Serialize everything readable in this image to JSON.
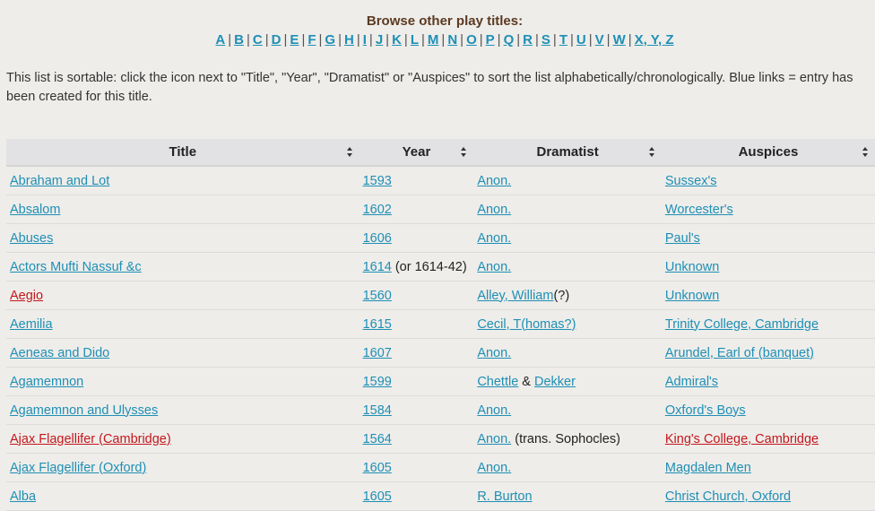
{
  "browse": {
    "heading": "Browse other play titles:",
    "letters": [
      "A",
      "B",
      "C",
      "D",
      "E",
      "F",
      "G",
      "H",
      "I",
      "J",
      "K",
      "L",
      "M",
      "N",
      "O",
      "P",
      "Q",
      "R",
      "S",
      "T",
      "U",
      "V",
      "W",
      "X, Y, Z"
    ],
    "separator": "|"
  },
  "intro_text": "This list is sortable: click the icon next to \"Title\", \"Year\", \"Dramatist\" or \"Auspices\" to sort the list alphabetically/chronologically. Blue links = entry has been created for this title.",
  "table": {
    "headers": [
      "Title",
      "Year",
      "Dramatist",
      "Auspices"
    ],
    "rows": [
      {
        "title": "Abraham and Lot",
        "title_color": "blue",
        "year": "1593",
        "year_note": "",
        "dramatist": [
          {
            "text": "Anon.",
            "link": "blue"
          }
        ],
        "auspices": "Sussex's",
        "auspices_color": "blue"
      },
      {
        "title": "Absalom",
        "title_color": "blue",
        "year": "1602",
        "year_note": "",
        "dramatist": [
          {
            "text": "Anon.",
            "link": "blue"
          }
        ],
        "auspices": "Worcester's",
        "auspices_color": "blue"
      },
      {
        "title": "Abuses",
        "title_color": "blue",
        "year": "1606",
        "year_note": "",
        "dramatist": [
          {
            "text": "Anon.",
            "link": "blue"
          }
        ],
        "auspices": "Paul's",
        "auspices_color": "blue"
      },
      {
        "title": "Actors Mufti Nassuf &c",
        "title_color": "blue",
        "year": "1614",
        "year_note": " (or 1614-42)",
        "dramatist": [
          {
            "text": "Anon.",
            "link": "blue"
          }
        ],
        "auspices": "Unknown",
        "auspices_color": "blue"
      },
      {
        "title": "Aegio",
        "title_color": "red",
        "year": "1560",
        "year_note": "",
        "dramatist": [
          {
            "text": "Alley, William",
            "link": "blue"
          },
          {
            "text": "(?)",
            "link": ""
          }
        ],
        "auspices": "Unknown",
        "auspices_color": "blue"
      },
      {
        "title": "Aemilia",
        "title_color": "blue",
        "year": "1615",
        "year_note": "",
        "dramatist": [
          {
            "text": "Cecil, T(homas?)",
            "link": "blue"
          }
        ],
        "auspices": "Trinity College, Cambridge",
        "auspices_color": "blue"
      },
      {
        "title": "Aeneas and Dido",
        "title_color": "blue",
        "year": "1607",
        "year_note": "",
        "dramatist": [
          {
            "text": "Anon.",
            "link": "blue"
          }
        ],
        "auspices": "Arundel, Earl of (banquet)",
        "auspices_color": "blue"
      },
      {
        "title": "Agamemnon",
        "title_color": "blue",
        "year": "1599",
        "year_note": "",
        "dramatist": [
          {
            "text": "Chettle",
            "link": "blue"
          },
          {
            "text": " & ",
            "link": ""
          },
          {
            "text": "Dekker",
            "link": "blue"
          }
        ],
        "auspices": "Admiral's",
        "auspices_color": "blue"
      },
      {
        "title": "Agamemnon and Ulysses",
        "title_color": "blue",
        "year": "1584",
        "year_note": "",
        "dramatist": [
          {
            "text": "Anon.",
            "link": "blue"
          }
        ],
        "auspices": "Oxford's Boys",
        "auspices_color": "blue"
      },
      {
        "title": "Ajax Flagellifer (Cambridge)",
        "title_color": "red",
        "year": "1564",
        "year_note": "",
        "dramatist": [
          {
            "text": "Anon.",
            "link": "blue"
          },
          {
            "text": " (trans. Sophocles)",
            "link": ""
          }
        ],
        "auspices": "King's College, Cambridge",
        "auspices_color": "red"
      },
      {
        "title": "Ajax Flagellifer (Oxford)",
        "title_color": "blue",
        "year": "1605",
        "year_note": "",
        "dramatist": [
          {
            "text": "Anon.",
            "link": "blue"
          }
        ],
        "auspices": "Magdalen Men",
        "auspices_color": "blue"
      },
      {
        "title": "Alba",
        "title_color": "blue",
        "year": "1605",
        "year_note": "",
        "dramatist": [
          {
            "text": "R. Burton",
            "link": "blue"
          }
        ],
        "auspices": "Christ Church, Oxford",
        "auspices_color": "blue"
      }
    ]
  }
}
